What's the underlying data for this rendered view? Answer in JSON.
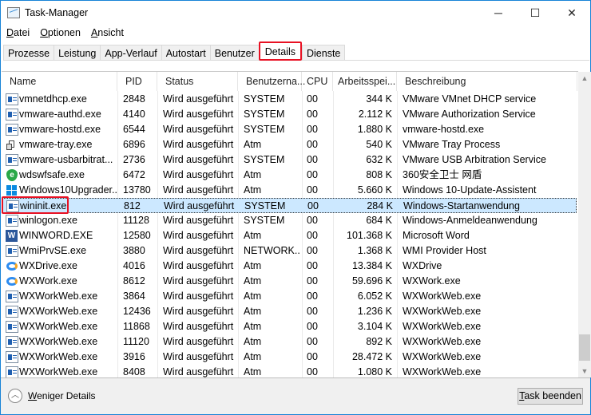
{
  "window": {
    "title": "Task-Manager",
    "minimize": "─",
    "maximize": "☐",
    "close": "✕"
  },
  "menu": [
    {
      "u": "D",
      "rest": "atei"
    },
    {
      "u": "O",
      "rest": "ptionen"
    },
    {
      "u": "A",
      "rest": "nsicht"
    }
  ],
  "tabs": [
    "Prozesse",
    "Leistung",
    "App-Verlauf",
    "Autostart",
    "Benutzer",
    "Details",
    "Dienste"
  ],
  "active_tab": "Details",
  "columns": [
    "Name",
    "PID",
    "Status",
    "Benutzerna...",
    "CPU",
    "Arbeitsspei...",
    "Beschreibung"
  ],
  "rows": [
    [
      "vmnetdhcp.exe",
      "2848",
      "Wird ausgeführt",
      "SYSTEM",
      "00",
      "344 K",
      "VMware VMnet DHCP service",
      "app"
    ],
    [
      "vmware-authd.exe",
      "4140",
      "Wird ausgeführt",
      "SYSTEM",
      "00",
      "2.112 K",
      "VMware Authorization Service",
      "app"
    ],
    [
      "vmware-hostd.exe",
      "6544",
      "Wird ausgeführt",
      "SYSTEM",
      "00",
      "1.880 K",
      "vmware-hostd.exe",
      "app"
    ],
    [
      "vmware-tray.exe",
      "6896",
      "Wird ausgeführt",
      "Atm",
      "00",
      "540 K",
      "VMware Tray Process",
      "tray"
    ],
    [
      "vmware-usbarbitrat...",
      "2736",
      "Wird ausgeführt",
      "SYSTEM",
      "00",
      "632 K",
      "VMware USB Arbitration Service",
      "app"
    ],
    [
      "wdswfsafe.exe",
      "6472",
      "Wird ausgeführt",
      "Atm",
      "00",
      "808 K",
      "360安全卫士 网盾",
      "shield"
    ],
    [
      "Windows10Upgrader...",
      "13780",
      "Wird ausgeführt",
      "Atm",
      "00",
      "5.660 K",
      "Windows 10-Update-Assistent",
      "windows"
    ],
    [
      "wininit.exe",
      "812",
      "Wird ausgeführt",
      "SYSTEM",
      "00",
      "284 K",
      "Windows-Startanwendung",
      "app"
    ],
    [
      "winlogon.exe",
      "11128",
      "Wird ausgeführt",
      "SYSTEM",
      "00",
      "684 K",
      "Windows-Anmeldeanwendung",
      "app"
    ],
    [
      "WINWORD.EXE",
      "12580",
      "Wird ausgeführt",
      "Atm",
      "00",
      "101.368 K",
      "Microsoft Word",
      "word"
    ],
    [
      "WmiPrvSE.exe",
      "3880",
      "Wird ausgeführt",
      "NETWORK...",
      "00",
      "1.368 K",
      "WMI Provider Host",
      "app"
    ],
    [
      "WXDrive.exe",
      "4016",
      "Wird ausgeführt",
      "Atm",
      "00",
      "13.384 K",
      "WXDrive",
      "wx"
    ],
    [
      "WXWork.exe",
      "8612",
      "Wird ausgeführt",
      "Atm",
      "00",
      "59.696 K",
      "WXWork.exe",
      "wx"
    ],
    [
      "WXWorkWeb.exe",
      "3864",
      "Wird ausgeführt",
      "Atm",
      "00",
      "6.052 K",
      "WXWorkWeb.exe",
      "app"
    ],
    [
      "WXWorkWeb.exe",
      "12436",
      "Wird ausgeführt",
      "Atm",
      "00",
      "1.236 K",
      "WXWorkWeb.exe",
      "app"
    ],
    [
      "WXWorkWeb.exe",
      "11868",
      "Wird ausgeführt",
      "Atm",
      "00",
      "3.104 K",
      "WXWorkWeb.exe",
      "app"
    ],
    [
      "WXWorkWeb.exe",
      "11120",
      "Wird ausgeführt",
      "Atm",
      "00",
      "892 K",
      "WXWorkWeb.exe",
      "app"
    ],
    [
      "WXWorkWeb.exe",
      "3916",
      "Wird ausgeführt",
      "Atm",
      "00",
      "28.472 K",
      "WXWorkWeb.exe",
      "app"
    ],
    [
      "WXWorkWeb.exe",
      "8408",
      "Wird ausgeführt",
      "Atm",
      "00",
      "1.080 K",
      "WXWorkWeb.exe",
      "app"
    ]
  ],
  "selected_row": 7,
  "footer": {
    "less_u": "W",
    "less_rest": "eniger Details",
    "end_u": "T",
    "end_rest": "ask beenden"
  }
}
